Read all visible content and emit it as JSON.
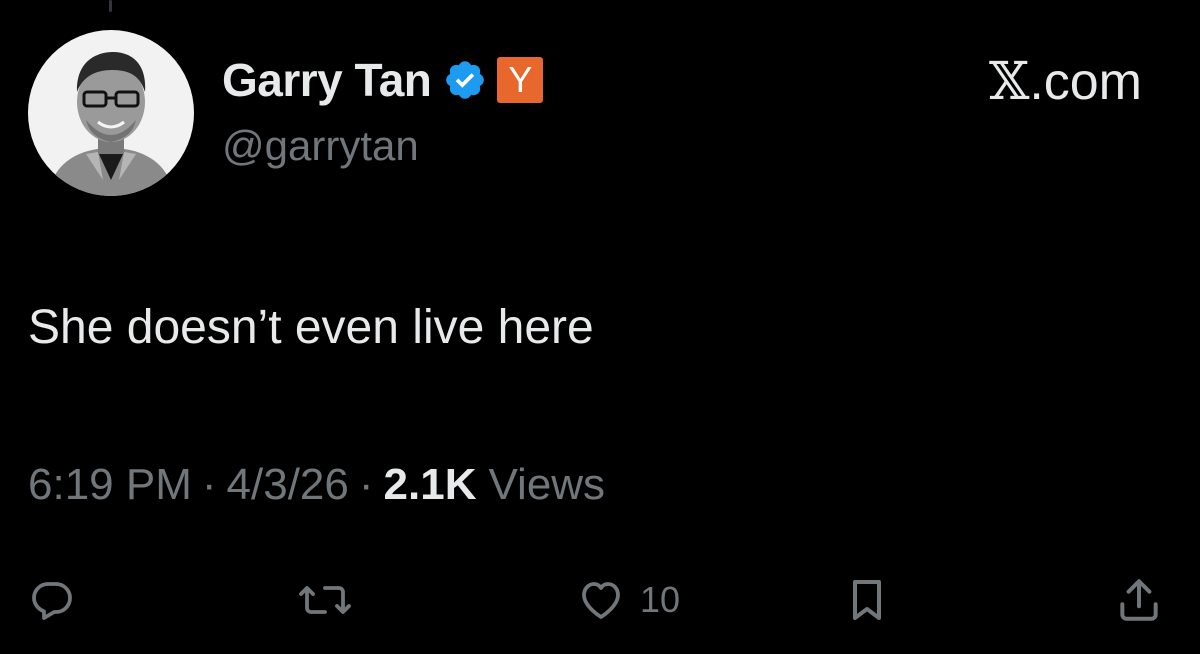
{
  "author": {
    "display_name": "Garry Tan",
    "handle": "@garrytan",
    "verified_icon": "verified-badge-icon",
    "affiliate_badge": "Y",
    "affiliate_color": "#e7672c",
    "verified_color": "#1d9bf0"
  },
  "watermark": {
    "x_glyph": "𝕏",
    "suffix": ".com"
  },
  "tweet": {
    "text": "She doesn’t even live here"
  },
  "meta": {
    "time": "6:19 PM",
    "date": "4/3/26",
    "separator": "·",
    "views_count": "2.1K",
    "views_label": "Views"
  },
  "actions": {
    "reply_icon": "reply-icon",
    "retweet_icon": "retweet-icon",
    "like_icon": "like-icon",
    "like_count": "10",
    "bookmark_icon": "bookmark-icon",
    "share_icon": "share-icon"
  },
  "colors": {
    "background": "#000000",
    "primary_text": "#e7e9ea",
    "secondary_text": "#71767b"
  }
}
